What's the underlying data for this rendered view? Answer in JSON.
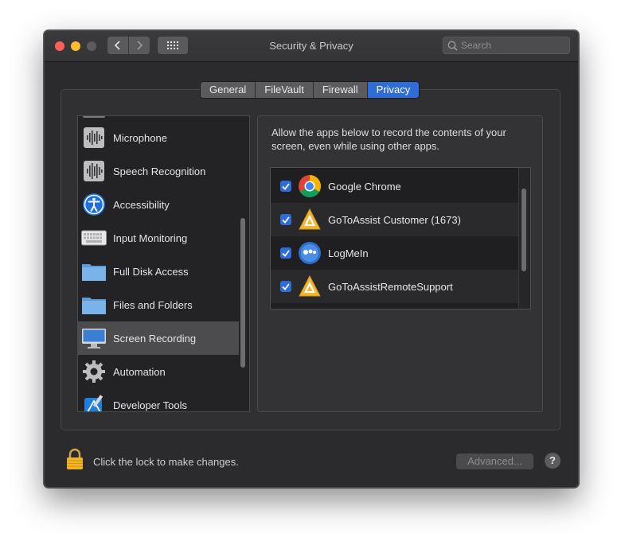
{
  "window": {
    "title": "Security & Privacy"
  },
  "search": {
    "placeholder": "Search"
  },
  "tabs": [
    {
      "label": "General"
    },
    {
      "label": "FileVault"
    },
    {
      "label": "Firewall"
    },
    {
      "label": "Privacy",
      "active": true
    }
  ],
  "sidebar": {
    "items": [
      {
        "label": "Microphone",
        "icon": "waveform-icon"
      },
      {
        "label": "Speech Recognition",
        "icon": "waveform-icon"
      },
      {
        "label": "Accessibility",
        "icon": "accessibility-icon"
      },
      {
        "label": "Input Monitoring",
        "icon": "keyboard-icon"
      },
      {
        "label": "Full Disk Access",
        "icon": "folder-icon"
      },
      {
        "label": "Files and Folders",
        "icon": "folder-icon"
      },
      {
        "label": "Screen Recording",
        "icon": "monitor-icon",
        "selected": true
      },
      {
        "label": "Automation",
        "icon": "gear-icon"
      },
      {
        "label": "Developer Tools",
        "icon": "developer-tools-icon"
      }
    ]
  },
  "panel": {
    "description": "Allow the apps below to record the contents of your screen, even while using other apps.",
    "apps": [
      {
        "name": "Google Chrome",
        "checked": true,
        "icon": "chrome-icon"
      },
      {
        "name": "GoToAssist Customer (1673)",
        "checked": true,
        "icon": "gotoassist-icon"
      },
      {
        "name": "LogMeIn",
        "checked": true,
        "icon": "logmein-icon"
      },
      {
        "name": "GoToAssistRemoteSupport",
        "checked": true,
        "icon": "gotoassist-icon"
      }
    ]
  },
  "footer": {
    "lock_text": "Click the lock to make changes.",
    "advanced_label": "Advanced...",
    "help_label": "?"
  },
  "colors": {
    "accent": "#2f6cd5",
    "window_bg": "#2b2b2d"
  }
}
